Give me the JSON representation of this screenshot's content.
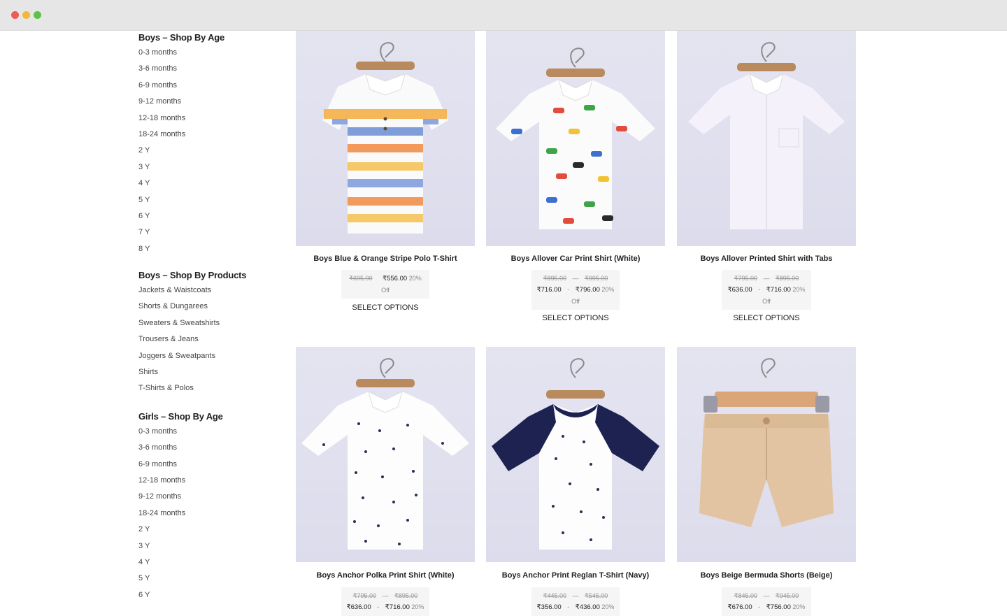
{
  "sidebar": {
    "boys_age": {
      "title": "Boys – Shop By Age",
      "items": [
        "0-3 months",
        "3-6 months",
        "6-9 months",
        "9-12 months",
        "12-18 months",
        "18-24 months",
        "2 Y",
        "3 Y",
        "4 Y",
        "5 Y",
        "6 Y",
        "7 Y",
        "8 Y"
      ]
    },
    "boys_products": {
      "title": "Boys – Shop By Products",
      "items": [
        "Jackets & Waistcoats",
        "Shorts & Dungarees",
        "Sweaters & Sweatshirts",
        "Trousers & Jeans",
        "Joggers & Sweatpants",
        "Shirts",
        "T-Shirts & Polos"
      ]
    },
    "girls_age": {
      "title": "Girls – Shop By Age",
      "items": [
        "0-3 months",
        "3-6 months",
        "6-9 months",
        "12-18 months",
        "9-12 months",
        "18-24 months",
        "2 Y",
        "3 Y",
        "4 Y",
        "5 Y",
        "6 Y"
      ]
    }
  },
  "products": [
    {
      "name": "Boys Blue & Orange Stripe Polo T-Shirt",
      "old_price": "₹695.00",
      "new_price": "₹556.00",
      "discount": "20%",
      "off": "Off",
      "cta": "SELECT OPTIONS"
    },
    {
      "name": "Boys Allover Car Print Shirt (White)",
      "old_low": "₹895.00",
      "old_high": "₹995.00",
      "new_low": "₹716.00",
      "new_high": "₹796.00",
      "discount": "20%",
      "off": "Off",
      "dash": "—",
      "range_sep": "-",
      "cta": "SELECT OPTIONS"
    },
    {
      "name": "Boys Allover Printed Shirt with Tabs",
      "old_low": "₹795.00",
      "old_high": "₹895.00",
      "new_low": "₹636.00",
      "new_high": "₹716.00",
      "discount": "20%",
      "off": "Off",
      "dash": "—",
      "range_sep": "-",
      "cta": "SELECT OPTIONS"
    },
    {
      "name": "Boys Anchor Polka Print Shirt (White)",
      "old_low": "₹795.00",
      "old_high": "₹895.00",
      "new_low": "₹636.00",
      "new_high": "₹716.00",
      "discount": "20%",
      "dash": "—",
      "range_sep": "-"
    },
    {
      "name": "Boys Anchor Print Reglan T-Shirt (Navy)",
      "old_low": "₹445.00",
      "old_high": "₹545.00",
      "new_low": "₹356.00",
      "new_high": "₹436.00",
      "discount": "20%",
      "dash": "—",
      "range_sep": "-"
    },
    {
      "name": "Boys Beige Bermuda Shorts (Beige)",
      "old_low": "₹845.00",
      "old_high": "₹945.00",
      "new_low": "₹676.00",
      "new_high": "₹756.00",
      "discount": "20%",
      "dash": "—",
      "range_sep": "-"
    }
  ],
  "colors": {
    "background": "#ffffff",
    "chrome": "#e6e6e6",
    "product_bg": "#e1e1ef",
    "price_box": "#f5f5f5",
    "text": "#222222"
  }
}
